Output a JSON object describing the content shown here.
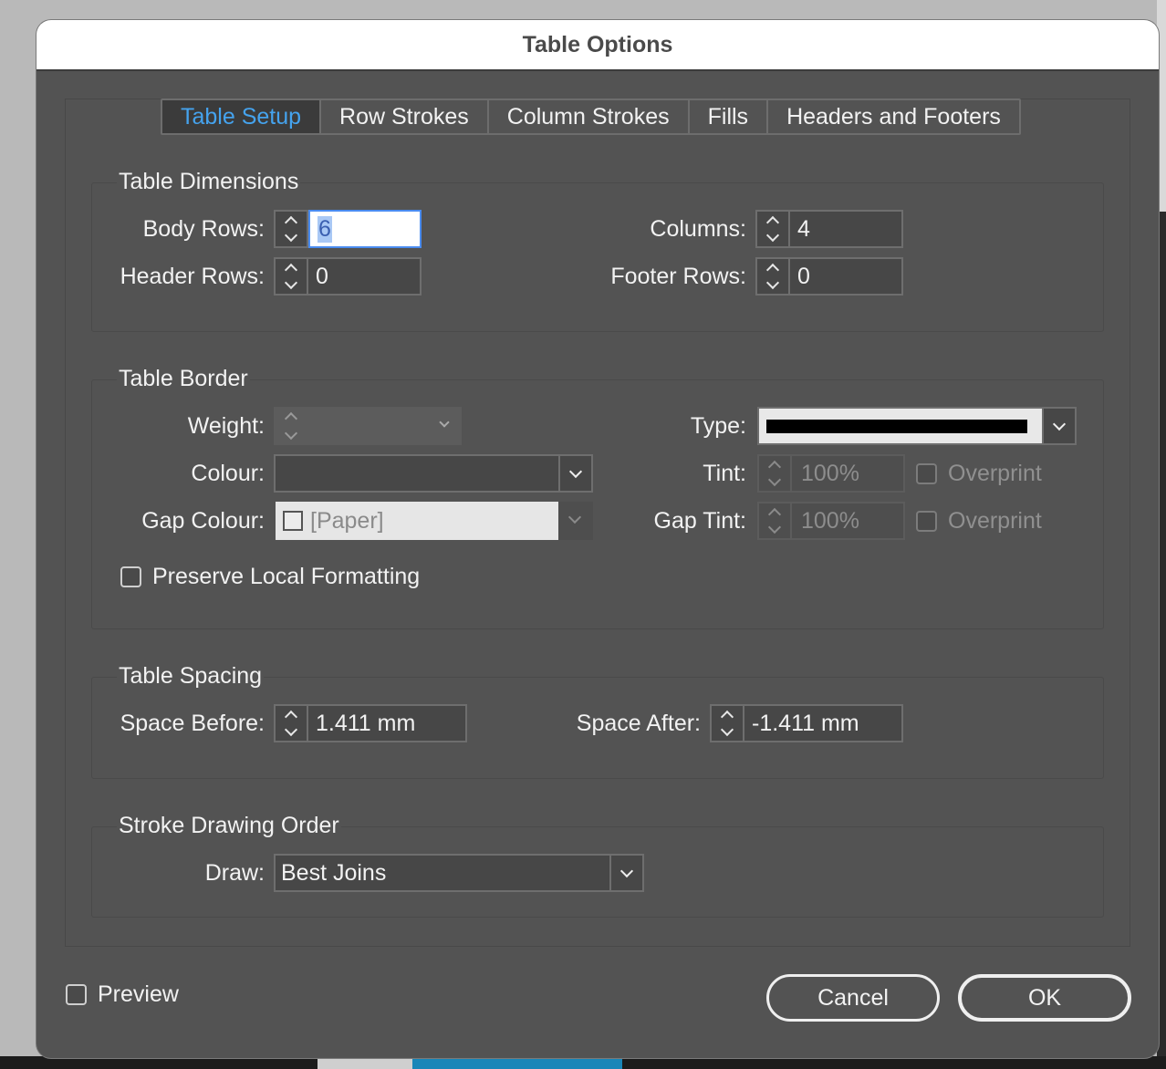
{
  "window": {
    "title": "Table Options"
  },
  "tabs": [
    {
      "label": "Table Setup",
      "active": true
    },
    {
      "label": "Row Strokes",
      "active": false
    },
    {
      "label": "Column Strokes",
      "active": false
    },
    {
      "label": "Fills",
      "active": false
    },
    {
      "label": "Headers and Footers",
      "active": false
    }
  ],
  "dimensions": {
    "title": "Table Dimensions",
    "body_rows_label": "Body Rows:",
    "body_rows_value": "6",
    "header_rows_label": "Header Rows:",
    "header_rows_value": "0",
    "columns_label": "Columns:",
    "columns_value": "4",
    "footer_rows_label": "Footer Rows:",
    "footer_rows_value": "0"
  },
  "border": {
    "title": "Table Border",
    "weight_label": "Weight:",
    "weight_value": "",
    "type_label": "Type:",
    "colour_label": "Colour:",
    "colour_value": "",
    "tint_label": "Tint:",
    "tint_value": "100%",
    "overprint_label": "Overprint",
    "gap_colour_label": "Gap Colour:",
    "gap_colour_value": "[Paper]",
    "gap_tint_label": "Gap Tint:",
    "gap_tint_value": "100%",
    "gap_overprint_label": "Overprint",
    "preserve_label": "Preserve Local Formatting"
  },
  "spacing": {
    "title": "Table Spacing",
    "before_label": "Space Before:",
    "before_value": "1.411 mm",
    "after_label": "Space After:",
    "after_value": "-1.411 mm"
  },
  "stroke_order": {
    "title": "Stroke Drawing Order",
    "draw_label": "Draw:",
    "draw_value": "Best Joins"
  },
  "footer": {
    "preview_label": "Preview",
    "cancel_label": "Cancel",
    "ok_label": "OK"
  },
  "colors": {
    "dialog_bg": "#535353",
    "active_tab_text": "#45a3ee",
    "focus_ring": "#4a8cf0"
  }
}
